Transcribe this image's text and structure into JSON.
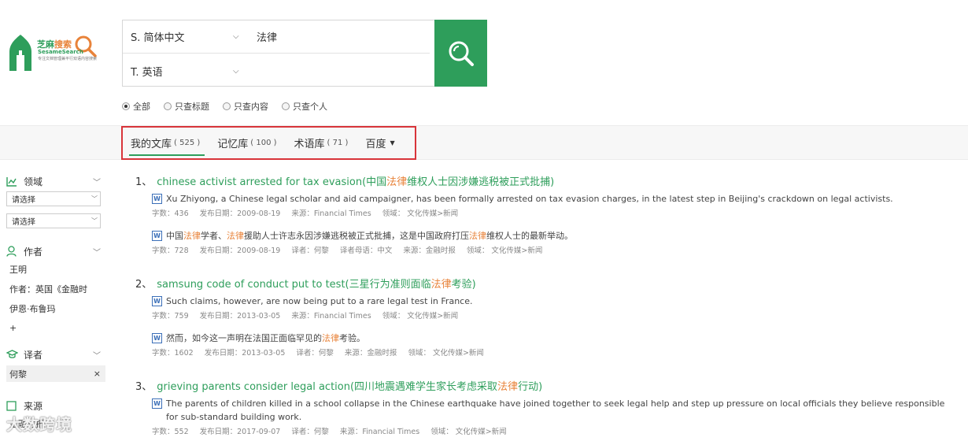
{
  "logo": {
    "brand_cn_1": "芝麻",
    "brand_cn_2": "搜索",
    "brand_en": "SesameSearch",
    "tagline": "专注文档管理兼平行双语内容搜索"
  },
  "search": {
    "source_lang": "S.  简体中文",
    "target_lang": "T.  英语",
    "query": "法律"
  },
  "scope": [
    "全部",
    "只查标题",
    "只查内容",
    "只查个人"
  ],
  "tabs": [
    {
      "label": "我的文库",
      "count": "( 525 )"
    },
    {
      "label": "记忆库",
      "count": "( 100 )"
    },
    {
      "label": "术语库",
      "count": "( 71 )"
    },
    {
      "label": "百度",
      "count": ""
    }
  ],
  "sidebar": {
    "domain_label": "领域",
    "select1": "请选择",
    "select2": "请选择",
    "author_label": "作者",
    "authors": [
      "王明",
      "作者：英国《金融时",
      "伊恩·布鲁玛",
      "+"
    ],
    "translator_label": "译者",
    "translator_chip": "何黎",
    "chip_close": "×",
    "source_label": "来源",
    "source_item": "金融时报"
  },
  "results": [
    {
      "num": "1、",
      "title_pre": "chinese activist arrested for tax evasion(中国",
      "title_hl": "法律",
      "title_post": "维权人士因涉嫌逃税被正式批捕)",
      "en_text": "Xu Zhiyong, a Chinese legal scholar and aid campaigner, has been formally arrested on tax evasion charges, in the latest step in Beijing's crackdown on legal activists.",
      "en_meta": [
        "字数：436",
        "发布日期：2009-08-19",
        "来源：Financial Times",
        "领域： 文化传媒>新闻"
      ],
      "cn_parts": [
        "中国",
        "法律",
        "学者、",
        "法律",
        "援助人士许志永因涉嫌逃税被正式批捕，这是中国政府打压",
        "法律",
        "维权人士的最新举动。"
      ],
      "cn_meta": [
        "字数：728",
        "发布日期：2009-08-19",
        "译者：何黎",
        "译者母语：中文",
        "来源：金融时报",
        "领域： 文化传媒>新闻"
      ]
    },
    {
      "num": "2、",
      "title_pre": "samsung code of conduct put to test(三星行为准则面临",
      "title_hl": "法律",
      "title_post": "考验)",
      "en_text": "Such claims, however, are now being put to a rare legal test in France.",
      "en_meta": [
        "字数：759",
        "发布日期：2013-03-05",
        "来源：Financial Times",
        "领域： 文化传媒>新闻"
      ],
      "cn_parts": [
        "然而，如今这一声明在法国正面临罕见的",
        "法律",
        "考验。"
      ],
      "cn_meta": [
        "字数：1602",
        "发布日期：2013-03-05",
        "译者：何黎",
        "来源：金融时报",
        "领域： 文化传媒>新闻"
      ]
    },
    {
      "num": "3、",
      "title_pre": "grieving parents consider legal action(四川地震遇难学生家长考虑采取",
      "title_hl": "法律",
      "title_post": "行动)",
      "en_text": "The parents of children killed in a school collapse in the Chinese earthquake have joined together to seek legal help and step up pressure on local officials they believe responsible for sub-standard building work.",
      "en_meta": [
        "字数：552",
        "发布日期：2017-09-07",
        "译者：何黎",
        "来源：Financial Times",
        "领域： 文化传媒>新闻"
      ]
    }
  ],
  "doc_icon": "W",
  "watermark": "大数跨境",
  "colors": {
    "brand_green": "#2e9e5b",
    "highlight": "#e8833a",
    "frame_red": "#d8343a"
  }
}
